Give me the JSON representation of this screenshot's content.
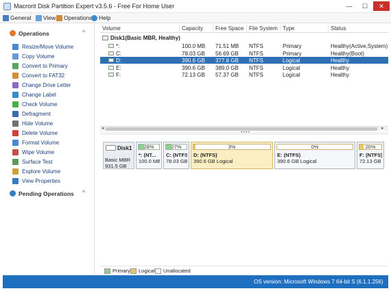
{
  "window": {
    "title": "Macrorit Disk Partition Expert v3.5.6 - Free For Home User",
    "min": "—",
    "max": "☐",
    "close": "✕"
  },
  "menu": [
    {
      "label": "General",
      "icon": "general-icon",
      "color": "#4a7dc0"
    },
    {
      "label": "View",
      "icon": "view-icon",
      "color": "#6aa0d8"
    },
    {
      "label": "Operations",
      "icon": "operations-icon",
      "color": "#d08a3a"
    },
    {
      "label": "Help",
      "icon": "help-icon",
      "color": "#3a8ad0"
    }
  ],
  "sidebar": {
    "operations_title": "Operations",
    "pending_title": "Pending Operations",
    "operations": [
      {
        "label": "Resize/Move Volume",
        "icon": "resize-icon",
        "color": "#4a8ad0"
      },
      {
        "label": "Copy Volume",
        "icon": "copy-icon",
        "color": "#6a9ad0"
      },
      {
        "label": "Convert to Primary",
        "icon": "convert-primary-icon",
        "color": "#59a85a"
      },
      {
        "label": "Convert to FAT32",
        "icon": "convert-fat32-icon",
        "color": "#d0903a"
      },
      {
        "label": "Change Drive Letter",
        "icon": "drive-letter-icon",
        "color": "#8a6ac0"
      },
      {
        "label": "Change Label",
        "icon": "label-icon",
        "color": "#3a8ad0"
      },
      {
        "label": "Check Volume",
        "icon": "check-icon",
        "color": "#4ab04a"
      },
      {
        "label": "Defragment",
        "icon": "defrag-icon",
        "color": "#3a6ab0"
      },
      {
        "label": "Hide Volume",
        "icon": "hide-icon",
        "color": "#707070"
      },
      {
        "label": "Delete Volume",
        "icon": "delete-icon",
        "color": "#d04040"
      },
      {
        "label": "Format Volume",
        "icon": "format-icon",
        "color": "#4a8ad0"
      },
      {
        "label": "Wipe Volume",
        "icon": "wipe-icon",
        "color": "#c0504a"
      },
      {
        "label": "Surface Test",
        "icon": "surface-test-icon",
        "color": "#5a9a5a"
      },
      {
        "label": "Explore Volume",
        "icon": "explore-icon",
        "color": "#d0a03a"
      },
      {
        "label": "View Properties",
        "icon": "properties-icon",
        "color": "#3a7ac0"
      }
    ]
  },
  "table": {
    "headers": [
      "Volume",
      "Capacity",
      "Free Space",
      "File System",
      "Type",
      "Status"
    ],
    "disk_label": "Disk1(Basic MBR, Healthy)",
    "rows": [
      {
        "volume": "*:",
        "capacity": "100.0 MB",
        "free": "71.51 MB",
        "fs": "NTFS",
        "type": "Primary",
        "status": "Healthy(Active,System)"
      },
      {
        "volume": "C:",
        "capacity": "78.03 GB",
        "free": "56.69 GB",
        "fs": "NTFS",
        "type": "Primary",
        "status": "Healthy(Boot)"
      },
      {
        "volume": "D:",
        "capacity": "390.6 GB",
        "free": "377.6 GB",
        "fs": "NTFS",
        "type": "Logical",
        "status": "Healthy"
      },
      {
        "volume": "E:",
        "capacity": "390.6 GB",
        "free": "389.0 GB",
        "fs": "NTFS",
        "type": "Logical",
        "status": "Healthy"
      },
      {
        "volume": "F:",
        "capacity": "72.13 GB",
        "free": "57.37 GB",
        "fs": "NTFS",
        "type": "Logical",
        "status": "Healthy"
      }
    ],
    "selected_index": 2
  },
  "splitter_dots": "••••",
  "diskmap": {
    "disk": {
      "name": "Disk1",
      "type": "Basic MBR",
      "size": "931.5 GB"
    },
    "partitions": [
      {
        "pct": "28%",
        "fill": 0.28,
        "name": "*: (NT...",
        "info": "100.0 MB P...",
        "kind": "primary"
      },
      {
        "pct": "27%",
        "fill": 0.27,
        "name": "C: (NTFS)",
        "info": "78.03 GB P...",
        "kind": "primary"
      },
      {
        "pct": "3%",
        "fill": 0.03,
        "name": "D: (NTFS)",
        "info": "390.6 GB Logical",
        "kind": "logical",
        "selected": true
      },
      {
        "pct": "0%",
        "fill": 0.0,
        "name": "E: (NTFS)",
        "info": "390.6 GB Logical",
        "kind": "logical"
      },
      {
        "pct": "20%",
        "fill": 0.2,
        "name": "F: (NTFS)",
        "info": "72.13 GB ...",
        "kind": "logical"
      }
    ]
  },
  "legend": [
    {
      "label": "Primary",
      "color": "#8fd08f"
    },
    {
      "label": "Logical",
      "color": "#e8c766"
    },
    {
      "label": "Unallocated",
      "color": "#ffffff"
    }
  ],
  "status": {
    "text": "OS version: Microsoft Windows 7  64-bit S (6.1.1.256)"
  }
}
